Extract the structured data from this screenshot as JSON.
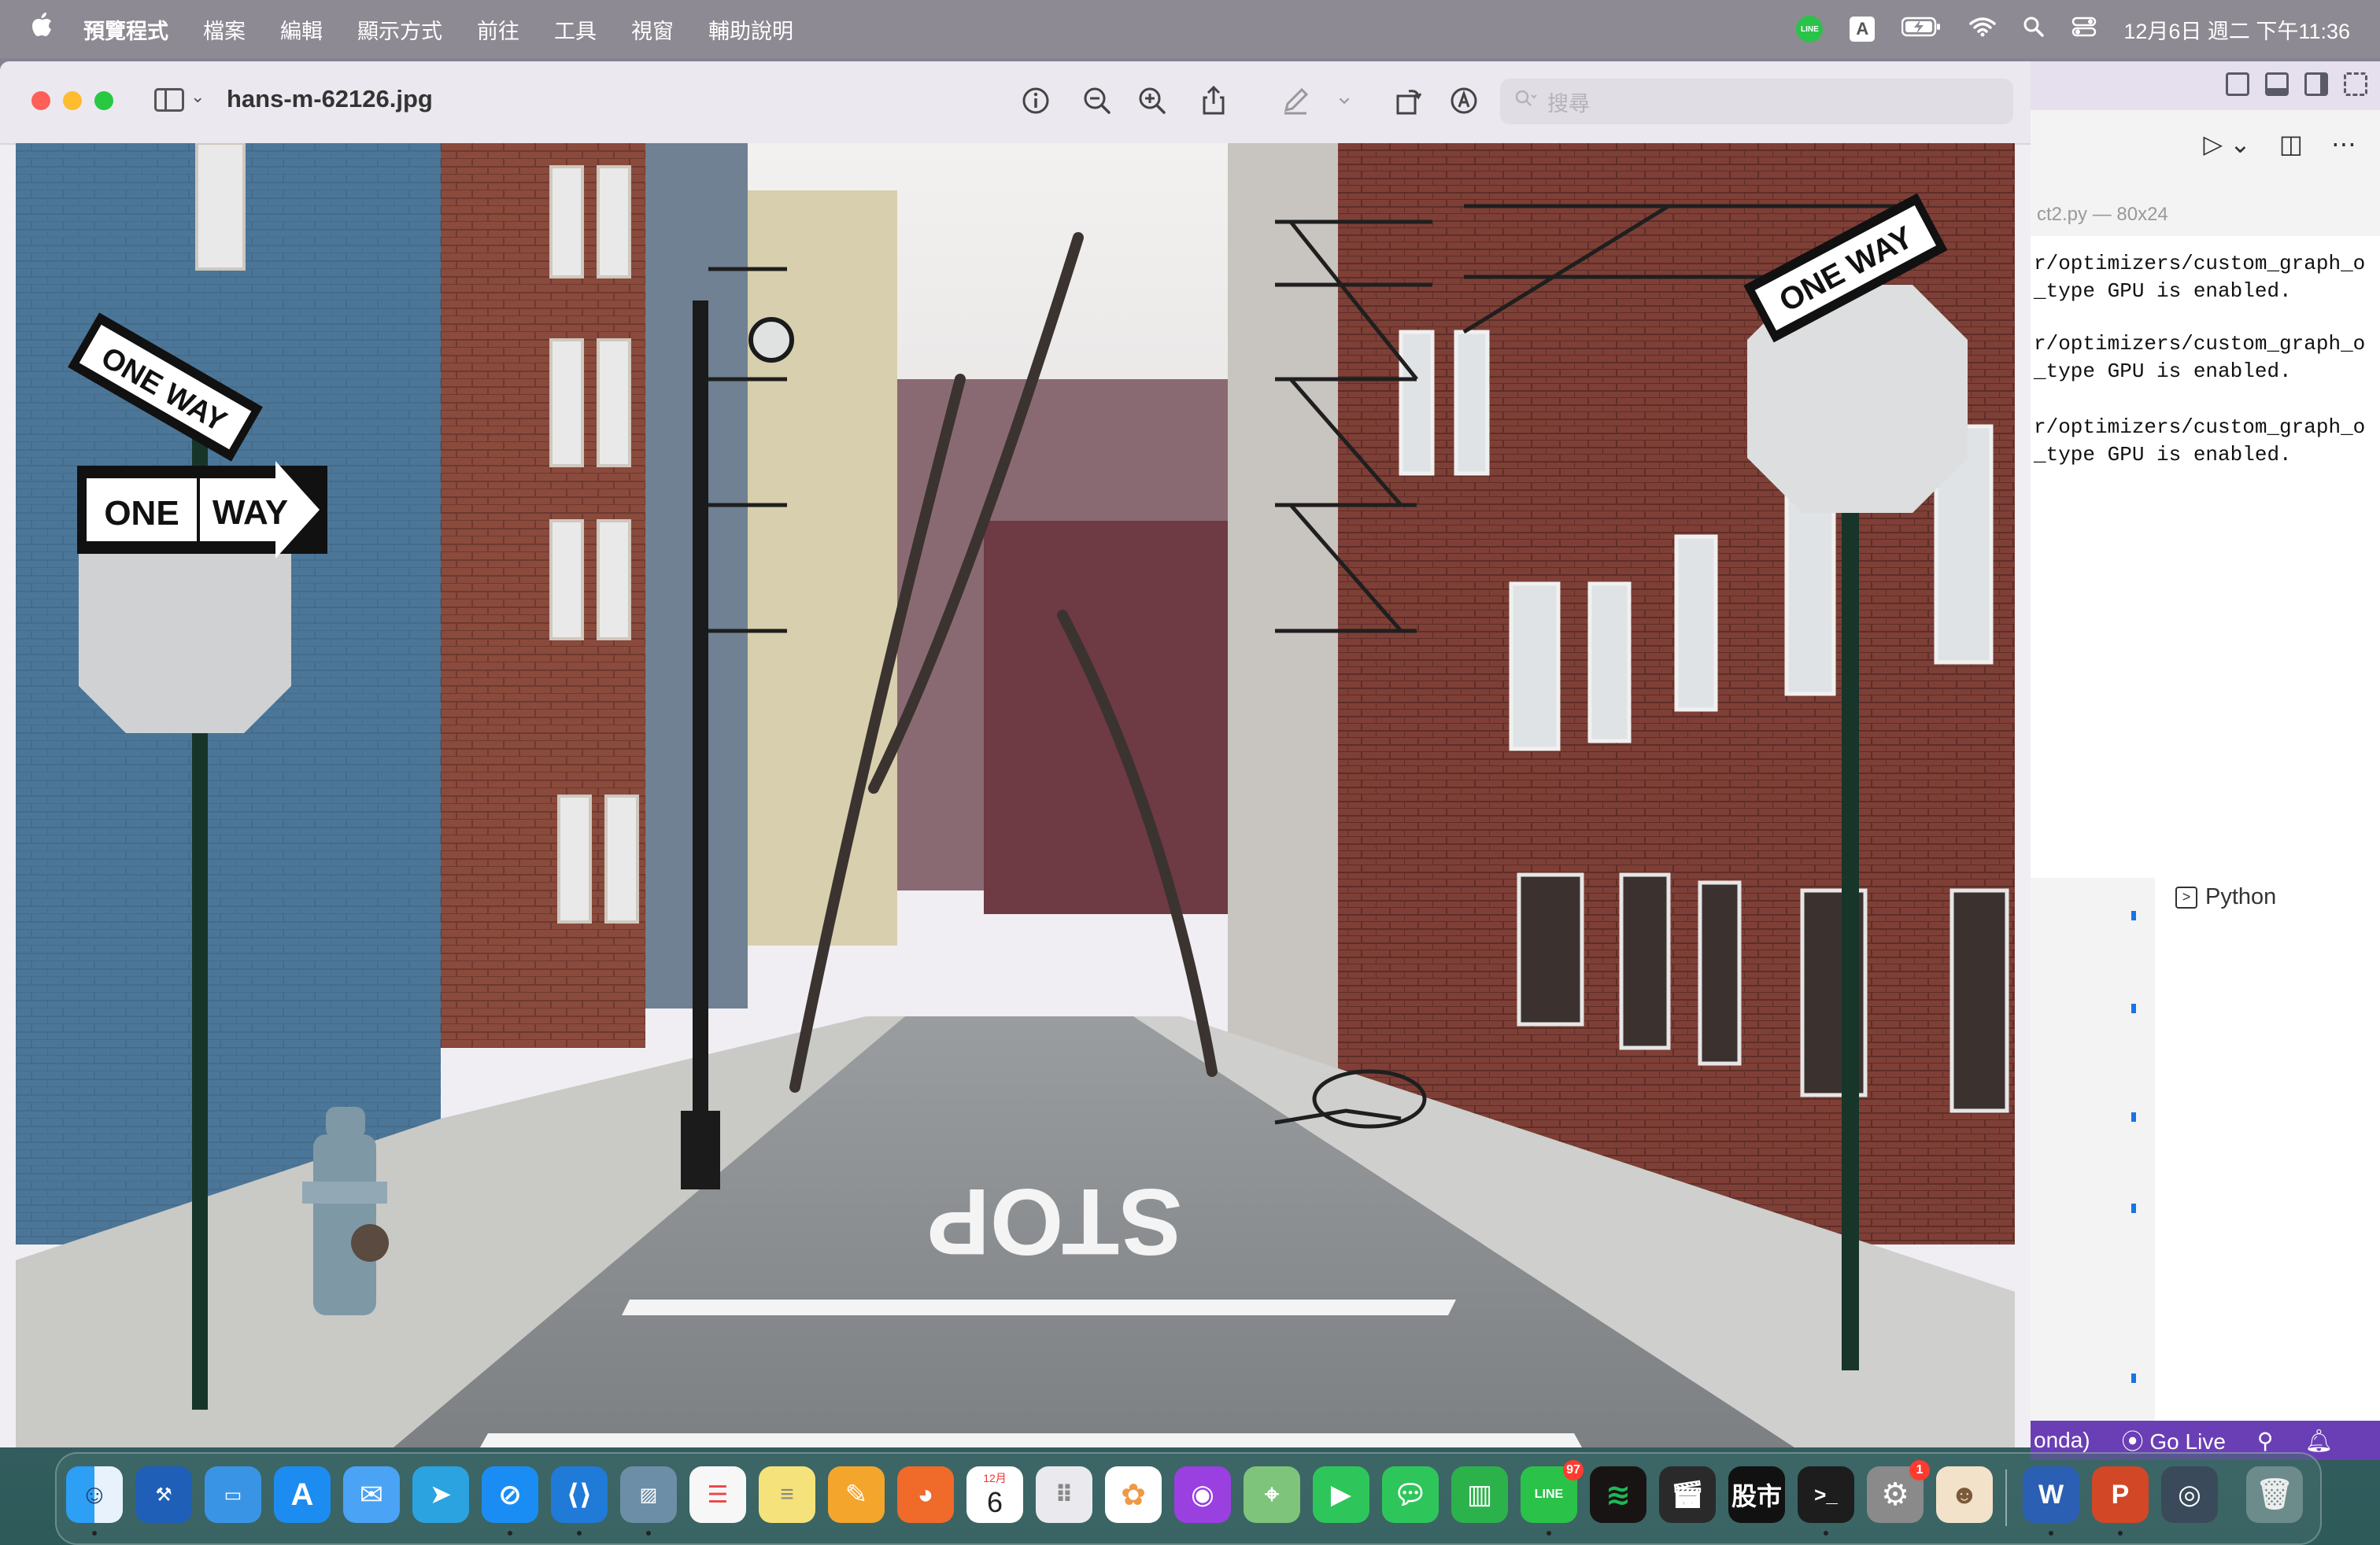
{
  "menubar": {
    "apple": "",
    "items": [
      "預覽程式",
      "檔案",
      "編輯",
      "顯示方式",
      "前往",
      "工具",
      "視窗",
      "輔助說明"
    ],
    "line_label": "LINE",
    "input_label": "A",
    "clock": "12月6日 週二 下午11:36"
  },
  "preview": {
    "title": "hans-m-62126.jpg",
    "search_placeholder": "搜尋",
    "photo_signs": {
      "one_way_left_top": "ONE WAY",
      "one_way_left_main_a": "ONE",
      "one_way_left_main_b": "WAY",
      "one_way_right": "ONE WAY",
      "street_marking": "STOP"
    }
  },
  "vscode": {
    "terminal_tab": "ct2.py — 80x24",
    "terminal_lines": [
      "r/optimizers/custom_graph_o",
      "_type GPU is enabled.",
      "r/optimizers/custom_graph_o",
      "_type GPU is enabled.",
      "r/optimizers/custom_graph_o",
      "_type GPU is enabled."
    ],
    "language": "Python",
    "status_env": "onda)",
    "status_golive": "Go Live"
  },
  "dock": {
    "calendar_month": "12月",
    "calendar_day": "6",
    "line_badge": "97",
    "settings_badge": "1",
    "stocks_label": "股市",
    "line_label": "LINE",
    "word_label": "W",
    "ppt_label": "P"
  }
}
